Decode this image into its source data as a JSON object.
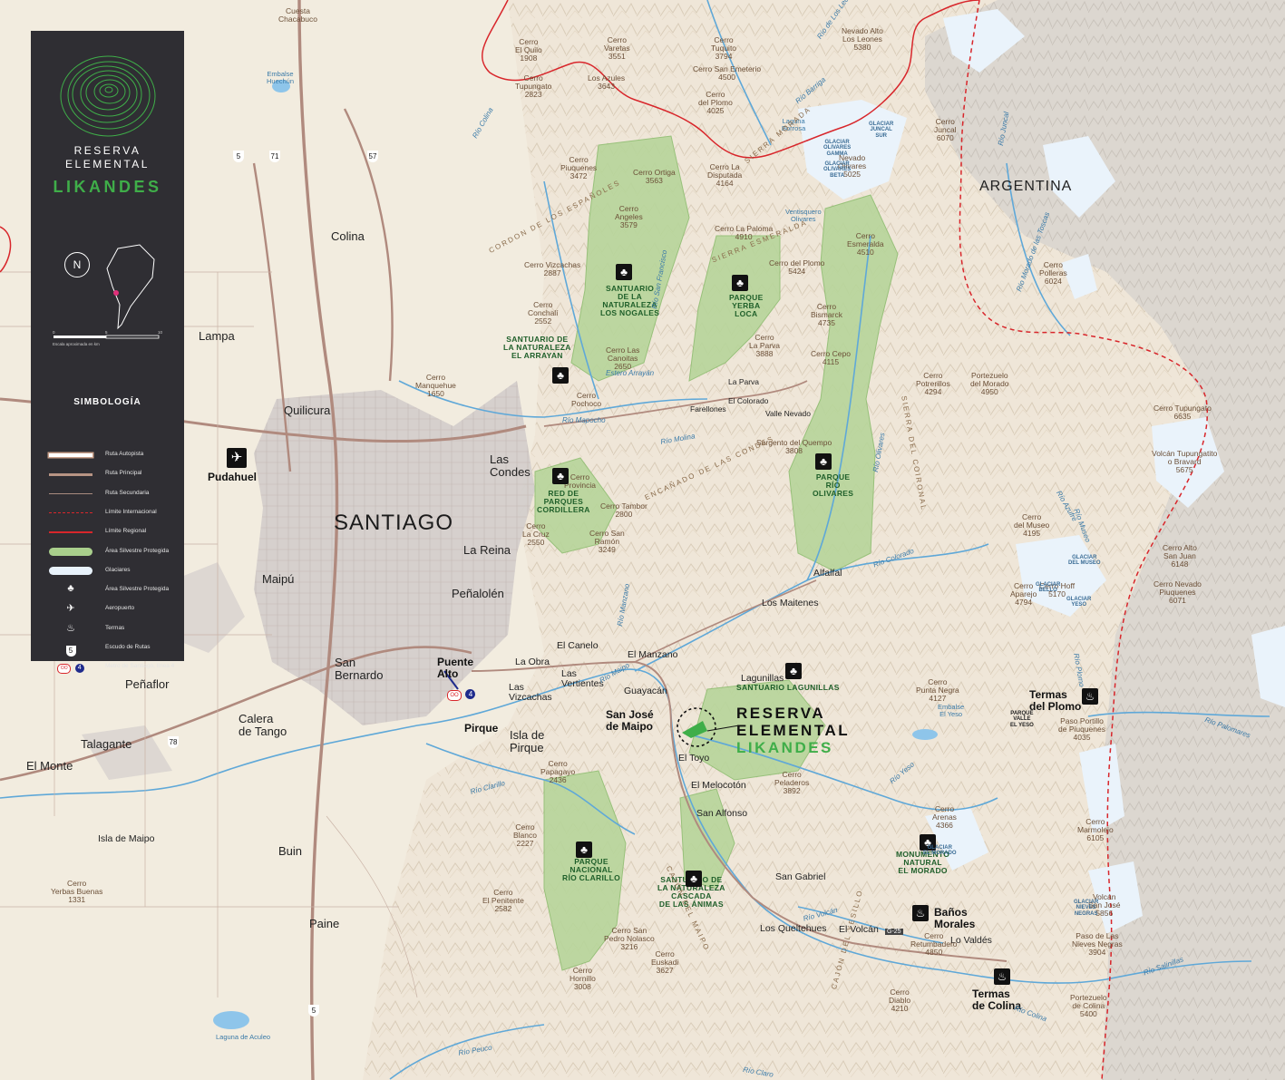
{
  "legend": {
    "title_line1": "RESERVA",
    "title_line2": "ELEMENTAL",
    "brand": "LIKANDES",
    "north": "N",
    "scale_label": "Escala aproximada en km",
    "scale_ticks": [
      "0",
      "5",
      "10"
    ],
    "symbology_title": "SIMBOLOGÍA",
    "items": [
      {
        "label": "Ruta Autopista",
        "kind": "line",
        "color": "#ffffff",
        "stroke": "#c9a08a",
        "width": 4
      },
      {
        "label": "Ruta Principal",
        "kind": "line",
        "color": "#b79484",
        "stroke": "#b79484",
        "width": 3
      },
      {
        "label": "Ruta Secundaria",
        "kind": "line",
        "color": "#a98b7e",
        "stroke": "#a98b7e",
        "width": 1
      },
      {
        "label": "Límite Internacional",
        "kind": "dash",
        "color": "#d8262b",
        "stroke": "#d8262b",
        "width": 1.5
      },
      {
        "label": "Límite Regional",
        "kind": "line",
        "color": "#d8262b",
        "stroke": "#d8262b",
        "width": 1.5
      },
      {
        "label": "Área Silvestre Protegida",
        "kind": "band",
        "color": "#a9cf8c",
        "stroke": "#a9cf8c",
        "width": 8
      },
      {
        "label": "Glaciares",
        "kind": "band",
        "color": "#e8f2fb",
        "stroke": "#e8f2fb",
        "width": 8
      },
      {
        "label": "Área Silvestre Protegida",
        "kind": "icon",
        "icon": "tree-icon",
        "glyph": "♣"
      },
      {
        "label": "Aeropuerto",
        "kind": "icon",
        "icon": "airplane-icon",
        "glyph": "✈"
      },
      {
        "label": "Termas",
        "kind": "icon",
        "icon": "hot-spring-icon",
        "glyph": "♨"
      },
      {
        "label": "Escudo de Rutas",
        "kind": "shield",
        "icon": "route-shield-icon",
        "glyph": "5"
      },
      {
        "label": "Metro de Santiago, línea 4",
        "kind": "metro",
        "icon": "metro-icon",
        "glyph": "4"
      }
    ]
  },
  "colors": {
    "terrain": "#efe6d8",
    "high_terrain": "#dcd7d0",
    "protected": "#b7d59a",
    "protected_stroke": "#8fbd71",
    "glacier": "#eaf3fb",
    "river": "#5fa8d8",
    "urban": "#d4cfcc",
    "road_main": "#b08a7e",
    "border_red": "#d8262b",
    "reserve_green": "#3fae49"
  },
  "cities": [
    {
      "name": "SANTIAGO"
    }
  ],
  "country": "ARGENTINA",
  "towns": [
    {
      "name": "Cuesta\nChacabuco",
      "style": "peak"
    },
    {
      "name": "Colina",
      "style": "town"
    },
    {
      "name": "Lampa",
      "style": "town"
    },
    {
      "name": "Quilicura",
      "style": "town"
    },
    {
      "name": "Pudahuel",
      "style": "town-b"
    },
    {
      "name": "Las\nCondes",
      "style": "town"
    },
    {
      "name": "La Reina",
      "style": "town"
    },
    {
      "name": "Maipú",
      "style": "town"
    },
    {
      "name": "Peñalolén",
      "style": "town"
    },
    {
      "name": "San\nBernardo",
      "style": "town"
    },
    {
      "name": "Puente\nAlto",
      "style": "town-b"
    },
    {
      "name": "Peñaflor",
      "style": "town"
    },
    {
      "name": "Calera\nde Tango",
      "style": "town"
    },
    {
      "name": "Talagante",
      "style": "town"
    },
    {
      "name": "El Monte",
      "style": "town"
    },
    {
      "name": "Isla de Maipo",
      "style": "town-s"
    },
    {
      "name": "Buin",
      "style": "town"
    },
    {
      "name": "Paine",
      "style": "town"
    },
    {
      "name": "Pirque",
      "style": "town-b"
    },
    {
      "name": "Isla de\nPirque",
      "style": "town"
    },
    {
      "name": "La Obra",
      "style": "town-s"
    },
    {
      "name": "Las\nVizcachas",
      "style": "town-s"
    },
    {
      "name": "El Canelo",
      "style": "town-s"
    },
    {
      "name": "Las\nVertientes",
      "style": "town-s"
    },
    {
      "name": "El Manzano",
      "style": "town-s"
    },
    {
      "name": "Guayacán",
      "style": "town-s"
    },
    {
      "name": "San José\nde Maipo",
      "style": "town-b"
    },
    {
      "name": "El Toyo",
      "style": "town-s"
    },
    {
      "name": "El Melocotón",
      "style": "town-s"
    },
    {
      "name": "San Alfonso",
      "style": "town-s"
    },
    {
      "name": "San Gabriel",
      "style": "town-s"
    },
    {
      "name": "Los Queltehues",
      "style": "town-s"
    },
    {
      "name": "El Volcán",
      "style": "town-s"
    },
    {
      "name": "Lo Valdés",
      "style": "town-s"
    },
    {
      "name": "Baños\nMorales",
      "style": "town-b"
    },
    {
      "name": "Termas\nde Colina",
      "style": "town-b"
    },
    {
      "name": "Termas\ndel Plomo",
      "style": "town-b"
    },
    {
      "name": "Lagunillas",
      "style": "town-s"
    },
    {
      "name": "Los Maitenes",
      "style": "town-s"
    },
    {
      "name": "Alfalfal",
      "style": "town-s"
    },
    {
      "name": "La Parva",
      "style": "town-xs"
    },
    {
      "name": "El Colorado",
      "style": "town-xs"
    },
    {
      "name": "Farellones",
      "style": "town-xs"
    },
    {
      "name": "Valle Nevado",
      "style": "town-xs"
    },
    {
      "name": "Paso Portillo\nde Piuquenes\n4035",
      "style": "peak"
    },
    {
      "name": "Paso de Las\nNieves Negras\n3904",
      "style": "peak"
    },
    {
      "name": "Portezuelo\nde Colina\n5400",
      "style": "peak"
    }
  ],
  "peaks": [
    "Cerro\nEl Quilo\n1908",
    "Cerro\nVaretas\n3551",
    "Cerro\nTuquito\n3794",
    "Nevado Alto\nLos Leones\n5380",
    "Cerro\nTupungato\n2823",
    "Los Azules\n3643",
    "Cerro San Emeterio\n4500",
    "Cerro\ndel Plomo\n4025",
    "Cerro\nJuncal\n6070",
    "Cerro\nPiuquenes\n3472",
    "Cerro Ortiga\n3563",
    "Cerro La\nDisputada\n4164",
    "Nevado\nOlivares\n5025",
    "Cerro\nAngeles\n3579",
    "Cerro La Paloma\n4910",
    "Cerro\nEsmeralda\n4510",
    "Cerro del Plomo\n5424",
    "Cerro Vizcachas\n2887",
    "Cerro\nPolleras\n6024",
    "Cerro\nConchalí\n2552",
    "Cerro\nBismarck\n4735",
    "Cerro Las\nCanoitas\n2650",
    "Cerro\nLa Parva\n3888",
    "Cerro\nManquehue\n1650",
    "Cerro\nPochoco",
    "Cerro Cepo\n4115",
    "Cerro\nPotrerillos\n4294",
    "Portezuelo\ndel Morado\n4950",
    "Cerro Tupungato\n6635",
    "Cerro\nProvincia",
    "Sargento del Quempo\n3808",
    "Volcán Tupungatito\no Bravard\n5675",
    "Cerro Tambor\n2800",
    "Cerro\nLa Cruz\n2550",
    "Cerro San\nRamón\n3249",
    "Cerro\ndel Museo\n4195",
    "Cerro Alto\nSan Juan\n6148",
    "Cerro\nAparejo\n4794",
    "Cerro Hoff\n5170",
    "Cerro Nevado\nPiuquenes\n6071",
    "Cerro\nPunta Negra\n4127",
    "Cerro\nPapagayo\n2436",
    "Cerro\nPeladeros\n3892",
    "Cerro\nArenas\n4366",
    "Cerro\nBlanco\n2227",
    "Cerro\nMarmolejo\n6105",
    "Cerro\nYerbas Buenas\n1331",
    "Cerro\nEl Penitente\n2582",
    "Cerro San\nPedro Nolasco\n3216",
    "Volcán\nSan José\n5856",
    "Cerro\nRetumbadero\n4850",
    "Cerro\nEuskadi\n3627",
    "Cerro\nHornillo\n3008",
    "Cerro\nDiablo\n4210"
  ],
  "parks": [
    {
      "name": "SANTUARIO\nDE LA\nNATURALEZA\nLOS NOGALES"
    },
    {
      "name": "PARQUE\nYERBA\nLOCA"
    },
    {
      "name": "SANTUARIO DE\nLA NATURALEZA\nEL ARRAYAN"
    },
    {
      "name": "RED DE\nPARQUES\nCORDILLERA"
    },
    {
      "name": "PARQUE\nRÍO\nOLIVARES"
    },
    {
      "name": "SANTUARIO LAGUNILLAS"
    },
    {
      "name": "PARQUE\nNACIONAL\nRÍO CLARILLO"
    },
    {
      "name": "SANTUARIO DE\nLA NATURALEZA\nCASCADA\nDE LAS ÁNIMAS"
    },
    {
      "name": "MONUMENTO\nNATURAL\nEL MORADO"
    }
  ],
  "glaciers": [
    "GLACIAR\nOLIVARES\nGAMMA",
    "GLACIAR\nJUNCAL\nSUR",
    "GLACIAR\nOLIVARES\nBETA",
    "GLACIAR\nDEL MUSEO",
    "GLACIAR\nBELLO",
    "GLACIAR\nYESO",
    "GLACIAR\nEL MORADO",
    "GLACIAR\nNIEVES\nNEGRAS"
  ],
  "waters": [
    "Embalse\nHuechún",
    "Laguna\nBorrosa",
    "Ventisquero\nOlivares",
    "Embalse\nEl Yeso",
    "PARQUE\nVALLE\nEL YESO",
    "Laguna de Aculeo"
  ],
  "rivers": [
    "Río Colina",
    "Río de Los Leones",
    "Río Barriga",
    "Río Mapocho",
    "Río Molina",
    "Río Olivares",
    "Río Colorado",
    "Río Maipo",
    "Río Clarillo",
    "Río Yeso",
    "Río Volcán",
    "Río Colina",
    "Río Peuco",
    "Río Claro",
    "Río San Francisco",
    "Estero Arrayán",
    "Río Juncal",
    "Río Manzano",
    "Río Palomares",
    "Río Azufre",
    "Río Museo",
    "Río Salinillas",
    "Río Plomo",
    "Río Morado de las Toscas"
  ],
  "ranges": [
    "CORDON DE LOS ESPAÑOLES",
    "SIERRA MORADA",
    "SIERRA ESMERALDA",
    "SIERRA DEL COIRONAL",
    "ENCAÑADO DE LAS CONDES",
    "CAJÓN DEL MAIPO",
    "CAJÓN DEL YESILLO"
  ],
  "routes": [
    "5",
    "71",
    "57",
    "78",
    "5",
    "G-25"
  ],
  "reserve": {
    "line1": "RESERVA",
    "line2": "ELEMENTAL",
    "line3": "LIKANDES"
  },
  "metro_line": "4"
}
